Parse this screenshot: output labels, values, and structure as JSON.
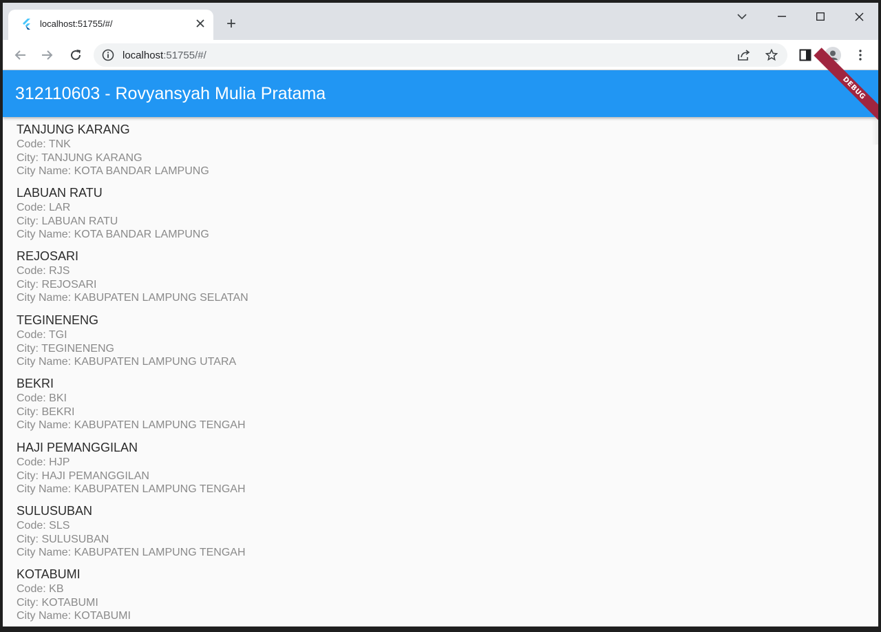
{
  "browser": {
    "tab_title": "localhost:51755/#/",
    "new_tab_label": "+",
    "url_host": "localhost",
    "url_rest": ":51755/#/"
  },
  "app": {
    "title": "312110603 - Rovyansyah Mulia Pratama",
    "debug_banner": "DEBUG",
    "accent_color": "#2196f3"
  },
  "stations": [
    {
      "name": "TANJUNG KARANG",
      "code": "Code: TNK",
      "city": "City: TANJUNG KARANG",
      "city_name": "City Name: KOTA BANDAR LAMPUNG"
    },
    {
      "name": "LABUAN RATU",
      "code": "Code: LAR",
      "city": "City: LABUAN RATU",
      "city_name": "City Name: KOTA BANDAR LAMPUNG"
    },
    {
      "name": "REJOSARI",
      "code": "Code: RJS",
      "city": "City: REJOSARI",
      "city_name": "City Name: KABUPATEN LAMPUNG SELATAN"
    },
    {
      "name": "TEGINENENG",
      "code": "Code: TGI",
      "city": "City: TEGINENENG",
      "city_name": "City Name: KABUPATEN LAMPUNG UTARA"
    },
    {
      "name": "BEKRI",
      "code": "Code: BKI",
      "city": "City: BEKRI",
      "city_name": "City Name: KABUPATEN LAMPUNG TENGAH"
    },
    {
      "name": "HAJI PEMANGGILAN",
      "code": "Code: HJP",
      "city": "City: HAJI PEMANGGILAN",
      "city_name": "City Name: KABUPATEN LAMPUNG TENGAH"
    },
    {
      "name": "SULUSUBAN",
      "code": "Code: SLS",
      "city": "City: SULUSUBAN",
      "city_name": "City Name: KABUPATEN LAMPUNG TENGAH"
    },
    {
      "name": "KOTABUMI",
      "code": "Code: KB",
      "city": "City: KOTABUMI",
      "city_name": "City Name: KOTABUMI"
    }
  ]
}
